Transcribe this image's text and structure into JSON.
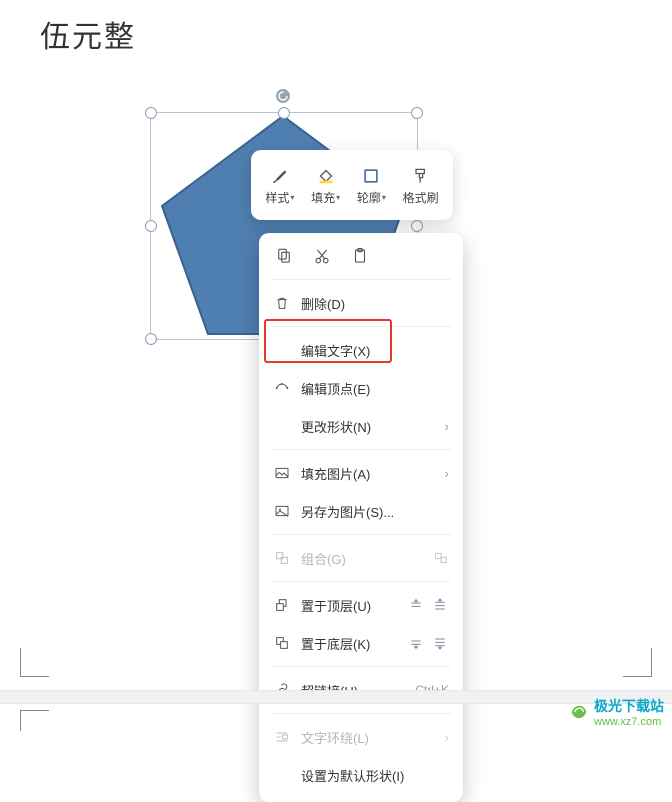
{
  "title": "伍元整",
  "shape": {
    "fill": "#4f7eb0",
    "stroke": "#3b628d"
  },
  "miniToolbar": {
    "style": "样式",
    "fill": "填充",
    "outline": "轮廓",
    "formatPainter": "格式刷"
  },
  "clipboard": {
    "copy_icon": "copy",
    "cut_icon": "cut",
    "paste_icon": "paste"
  },
  "menu": {
    "delete": "删除(D)",
    "editText": "编辑文字(X)",
    "editPoints": "编辑顶点(E)",
    "changeShape": "更改形状(N)",
    "fillPicture": "填充图片(A)",
    "saveAsPicture": "另存为图片(S)...",
    "group": "组合(G)",
    "bringFront": "置于顶层(U)",
    "sendBack": "置于底层(K)",
    "hyperlink": "超链接(H)...",
    "hyperlinkShortcut": "Ctrl+K",
    "textWrap": "文字环绕(L)",
    "setDefault": "设置为默认形状(I)"
  },
  "watermark": {
    "site": "极光下载站",
    "url": "www.xz7.com"
  }
}
